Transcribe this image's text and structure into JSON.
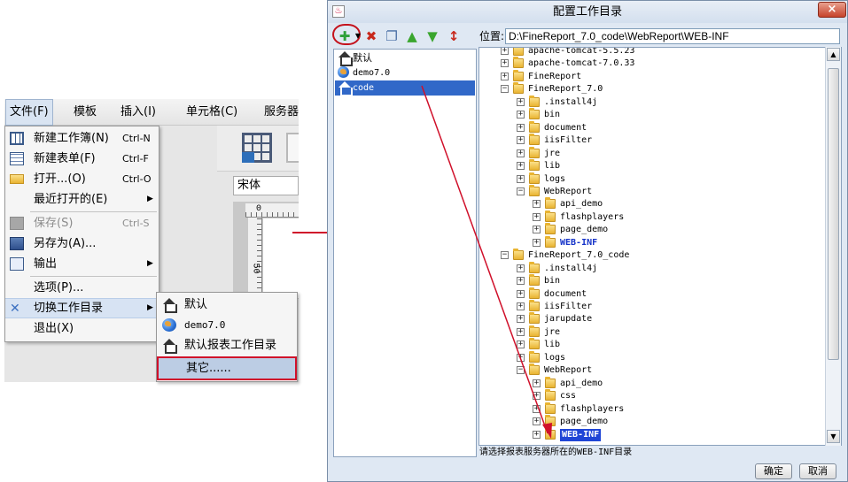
{
  "left": {
    "menubar": [
      "文件(F)",
      "模板",
      "插入(I)",
      "单元格(C)",
      "服务器"
    ],
    "font_combo": "宋体",
    "ruler_h_label": "0",
    "ruler_v_label": "50",
    "file_menu": [
      {
        "label": "新建工作簿(N)",
        "shortcut": "Ctrl-N",
        "icon": "workbook-icon"
      },
      {
        "label": "新建表单(F)",
        "shortcut": "Ctrl-F",
        "icon": "form-icon"
      },
      {
        "label": "打开...(O)",
        "shortcut": "Ctrl-O",
        "icon": "folder-icon"
      },
      {
        "label": "最近打开的(E)",
        "shortcut": "",
        "icon": ""
      },
      {
        "label": "保存(S)",
        "shortcut": "Ctrl-S",
        "icon": "save-icon"
      },
      {
        "label": "另存为(A)...",
        "shortcut": "",
        "icon": "save-as-icon"
      },
      {
        "label": "输出",
        "shortcut": "",
        "icon": "export-icon"
      },
      {
        "label": "选项(P)...",
        "shortcut": "",
        "icon": ""
      },
      {
        "label": "切换工作目录",
        "shortcut": "",
        "icon": "switch-icon"
      },
      {
        "label": "退出(X)",
        "shortcut": "",
        "icon": ""
      }
    ],
    "sub_menu": [
      {
        "label": "默认",
        "icon": "home-icon"
      },
      {
        "label": "demo7.0",
        "icon": "globe-icon"
      },
      {
        "label": "默认报表工作目录",
        "icon": "home-icon"
      },
      {
        "label": "其它......",
        "icon": ""
      }
    ]
  },
  "dialog": {
    "title": "配置工作目录",
    "close": "×",
    "location_label": "位置:",
    "location_value": "D:\\FineReport_7.0_code\\WebReport\\WEB-INF",
    "toolbar": {
      "add": "✚",
      "delete": "✖",
      "copy": "❐",
      "up": "▲",
      "down": "▼",
      "sort": "↕"
    },
    "list": [
      "默认",
      "demo7.0",
      "code"
    ],
    "tree": [
      {
        "level": 0,
        "toggle": "+",
        "label": "apache-tomcat-5.5.23"
      },
      {
        "level": 0,
        "toggle": "+",
        "label": "apache-tomcat-7.0.33"
      },
      {
        "level": 0,
        "toggle": "+",
        "label": "FineReport"
      },
      {
        "level": 0,
        "toggle": "−",
        "label": "FineReport_7.0"
      },
      {
        "level": 1,
        "toggle": "+",
        "label": ".install4j"
      },
      {
        "level": 1,
        "toggle": "+",
        "label": "bin"
      },
      {
        "level": 1,
        "toggle": "+",
        "label": "document"
      },
      {
        "level": 1,
        "toggle": "+",
        "label": "iisFilter"
      },
      {
        "level": 1,
        "toggle": "+",
        "label": "jre"
      },
      {
        "level": 1,
        "toggle": "+",
        "label": "lib"
      },
      {
        "level": 1,
        "toggle": "+",
        "label": "logs"
      },
      {
        "level": 1,
        "toggle": "−",
        "label": "WebReport"
      },
      {
        "level": 2,
        "toggle": "+",
        "label": "api_demo"
      },
      {
        "level": 2,
        "toggle": "+",
        "label": "flashplayers"
      },
      {
        "level": 2,
        "toggle": "+",
        "label": "page_demo"
      },
      {
        "level": 2,
        "toggle": "+",
        "label": "WEB-INF",
        "style": "bold"
      },
      {
        "level": 0,
        "toggle": "−",
        "label": "FineReport_7.0_code"
      },
      {
        "level": 1,
        "toggle": "+",
        "label": ".install4j"
      },
      {
        "level": 1,
        "toggle": "+",
        "label": "bin"
      },
      {
        "level": 1,
        "toggle": "+",
        "label": "document"
      },
      {
        "level": 1,
        "toggle": "+",
        "label": "iisFilter"
      },
      {
        "level": 1,
        "toggle": "+",
        "label": "jarupdate"
      },
      {
        "level": 1,
        "toggle": "+",
        "label": "jre"
      },
      {
        "level": 1,
        "toggle": "+",
        "label": "lib"
      },
      {
        "level": 1,
        "toggle": "+",
        "label": "logs"
      },
      {
        "level": 1,
        "toggle": "−",
        "label": "WebReport"
      },
      {
        "level": 2,
        "toggle": "+",
        "label": "api_demo"
      },
      {
        "level": 2,
        "toggle": "+",
        "label": "css"
      },
      {
        "level": 2,
        "toggle": "+",
        "label": "flashplayers"
      },
      {
        "level": 2,
        "toggle": "+",
        "label": "page_demo"
      },
      {
        "level": 2,
        "toggle": "+",
        "label": "WEB-INF",
        "style": "sel"
      }
    ],
    "status": "请选择报表服务器所在的WEB-INF目录",
    "ok": "确定",
    "cancel": "取消"
  },
  "colors": {
    "annotation": "#d0102a",
    "selection": "#3168c8"
  }
}
